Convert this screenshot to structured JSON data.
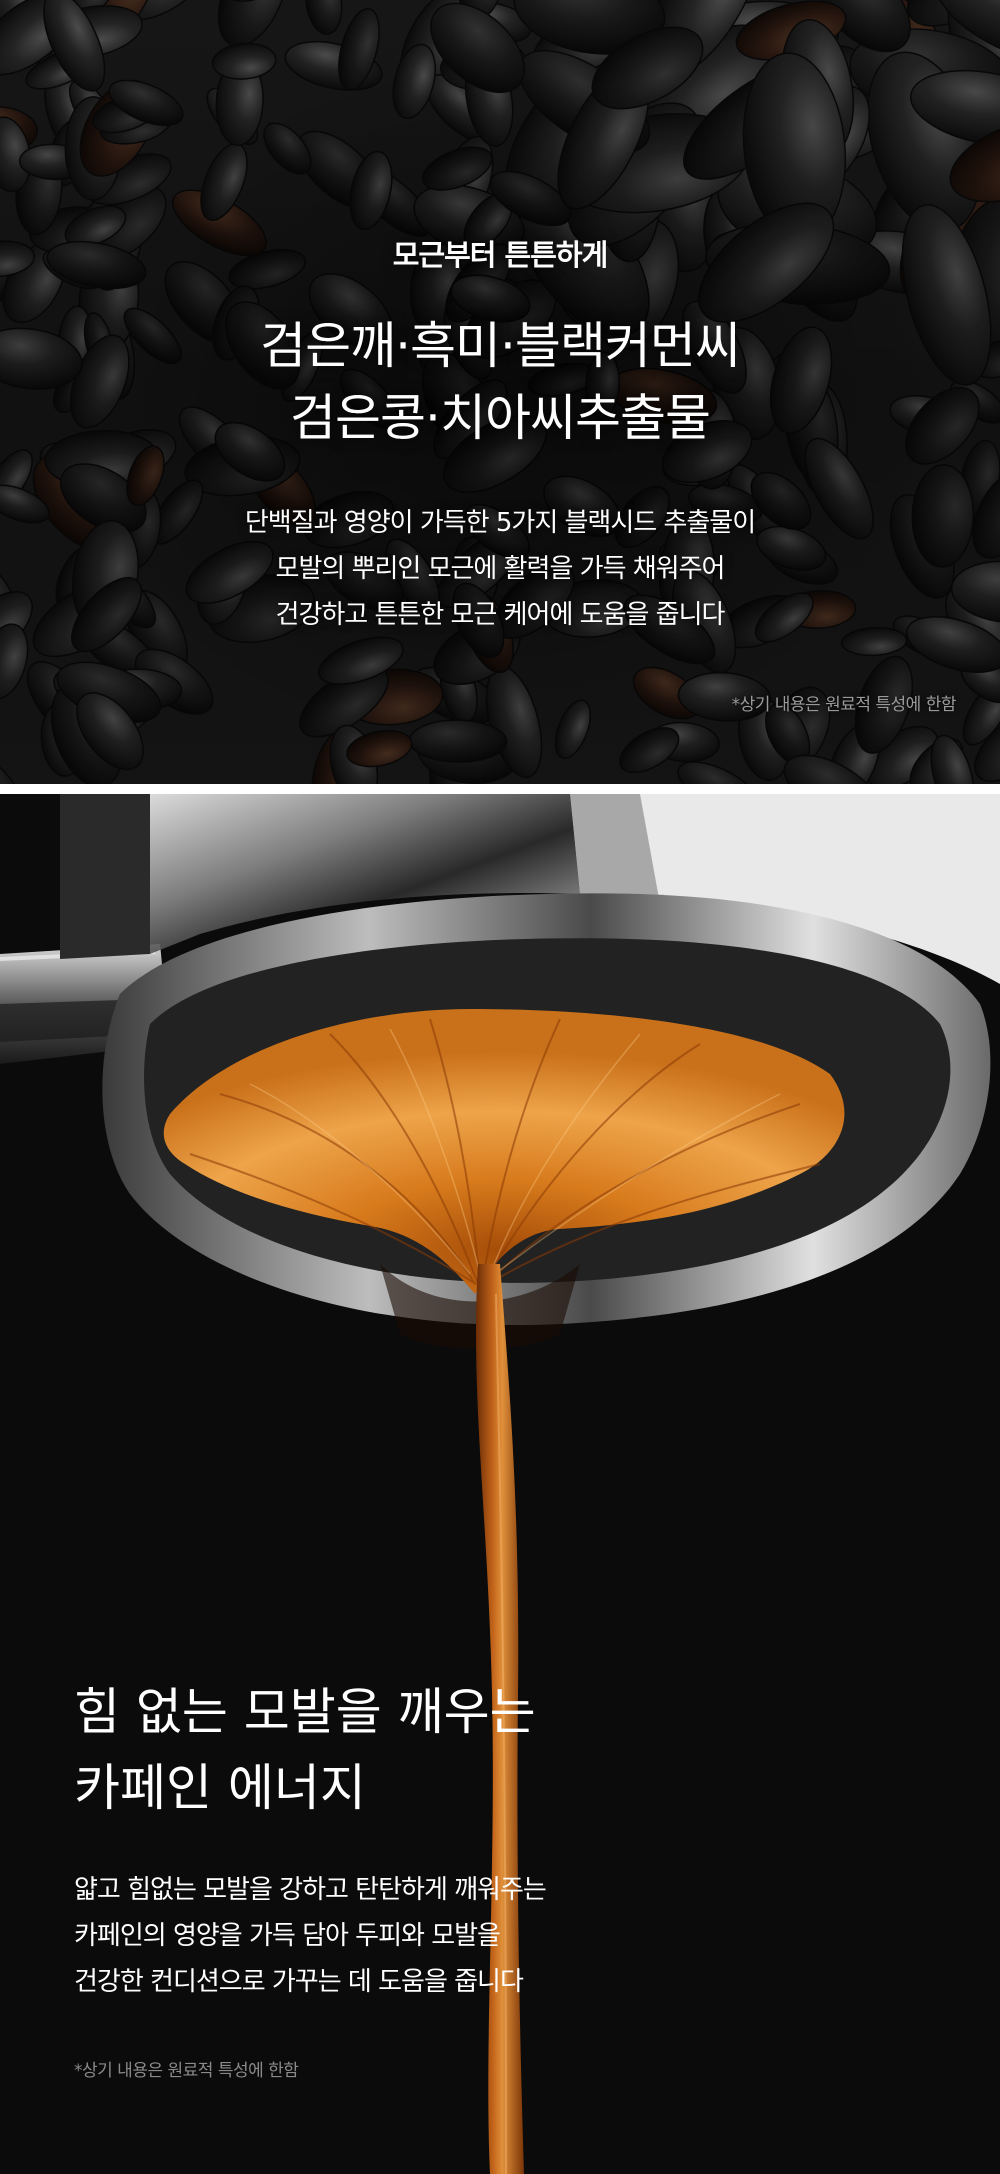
{
  "seeds_section": {
    "eyebrow": "모근부터 튼튼하게",
    "title_lines": [
      "검은깨·흑미·블랙커먼씨",
      "검은콩·치아씨추출물"
    ],
    "desc_lines": [
      "단백질과 영양이 가득한 5가지 블랙시드 추출물이",
      "모발의 뿌리인 모근에 활력을 가득 채워주어",
      "건강하고 튼튼한 모근 케어에 도움을 줍니다"
    ],
    "note": "*상기 내용은 원료적 특성에 한함",
    "image": "black-seeds-photo"
  },
  "espresso_section": {
    "title_lines": [
      "힘 없는 모발을 깨우는",
      "카페인 에너지"
    ],
    "desc_lines": [
      "얇고 힘없는 모발을 강하고 탄탄하게 깨워주는",
      "카페인의 영양을 가득 담아 두피와 모발을",
      "건강한 컨디션으로 가꾸는 데 도움을 줍니다"
    ],
    "note": "*상기 내용은 원료적 특성에 한함",
    "image": "espresso-extraction-photo"
  },
  "colors": {
    "background": "#0b0b0b",
    "text": "#ffffff",
    "note": "#9a9a9a",
    "espresso": "#d4731a"
  }
}
